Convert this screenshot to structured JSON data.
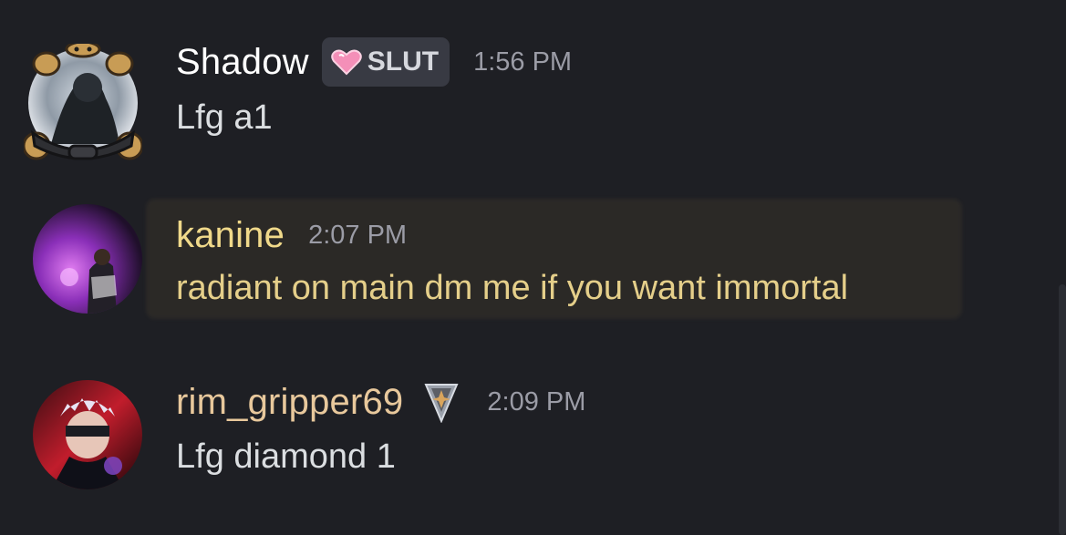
{
  "messages": [
    {
      "username": "Shadow",
      "username_color": "#ffffff",
      "tag": {
        "icon": "pink-heart-icon",
        "label": "SLUT"
      },
      "time": "1:56 PM",
      "text": "Lfg a1",
      "avatar_decoration": "bear-decoration"
    },
    {
      "username": "kanine",
      "username_color": "#f0d98a",
      "time": "2:07 PM",
      "text": "radiant on main dm me if you want immortal",
      "text_color": "#e5cf8a",
      "highlighted": true
    },
    {
      "username": "rim_gripper69",
      "username_color": "#e8c89c",
      "badge_icon": "diamond-rank-icon",
      "time": "2:09 PM",
      "text": "Lfg diamond 1"
    }
  ]
}
